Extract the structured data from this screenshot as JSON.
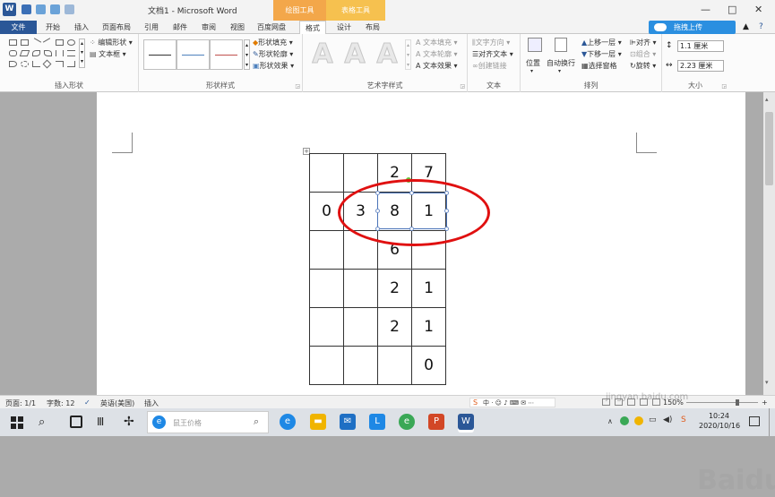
{
  "titlebar": {
    "logo": "W",
    "title": "文档1 - Microsoft Word",
    "context_drawing": "绘图工具",
    "context_table": "表格工具",
    "minimize": "—",
    "restore": "□",
    "close": "✕"
  },
  "tabs": {
    "file": "文件",
    "items": [
      "开始",
      "插入",
      "页面布局",
      "引用",
      "邮件",
      "审阅",
      "视图",
      "百度网盘"
    ],
    "format": "格式",
    "design": "设计",
    "layout": "布局",
    "upload": "拖拽上传"
  },
  "ribbon": {
    "insert_shapes": {
      "edit_shape": "编辑形状",
      "textbox": "文本框",
      "label": "插入形状"
    },
    "shape_styles": {
      "fill": "形状填充",
      "outline": "形状轮廓",
      "effects": "形状效果",
      "label": "形状样式"
    },
    "wordart": {
      "bigA": "A",
      "text_fill": "文本填充",
      "text_outline": "文本轮廓",
      "text_effects": "文本效果",
      "label": "艺术字样式"
    },
    "text": {
      "direction": "文字方向",
      "align": "对齐文本",
      "link": "创建链接",
      "label": "文本"
    },
    "arrange": {
      "position": "位置",
      "wrap": "自动换行",
      "forward": "上移一层",
      "backward": "下移一层",
      "selection": "选择窗格",
      "align": "对齐",
      "group": "组合",
      "rotate": "旋转",
      "label": "排列"
    },
    "size": {
      "height": "1.1 厘米",
      "width": "2.23 厘米",
      "label": "大小"
    }
  },
  "table": {
    "rows": [
      [
        "",
        "",
        "2",
        "7"
      ],
      [
        "0",
        "3",
        "8",
        "1"
      ],
      [
        "",
        "",
        "6",
        ""
      ],
      [
        "",
        "",
        "2",
        "1"
      ],
      [
        "",
        "",
        "2",
        "1"
      ],
      [
        "",
        "",
        "",
        "0"
      ]
    ]
  },
  "statusbar": {
    "page": "页面: 1/1",
    "words": "字数: 12",
    "lang": "英语(美国)",
    "mode": "插入",
    "zoom": "150%"
  },
  "taskbar": {
    "search_placeholder": "鼠王价格",
    "time": "10:24",
    "date": "2020/10/16"
  },
  "watermark": {
    "text": "Baidu经验",
    "url": "jingyan.baidu.com"
  },
  "colors": {
    "word_blue": "#2b5797",
    "highlight_red": "#e01010",
    "ctx_orange": "#f3a74a",
    "ctx_yellow": "#f6c14f"
  }
}
